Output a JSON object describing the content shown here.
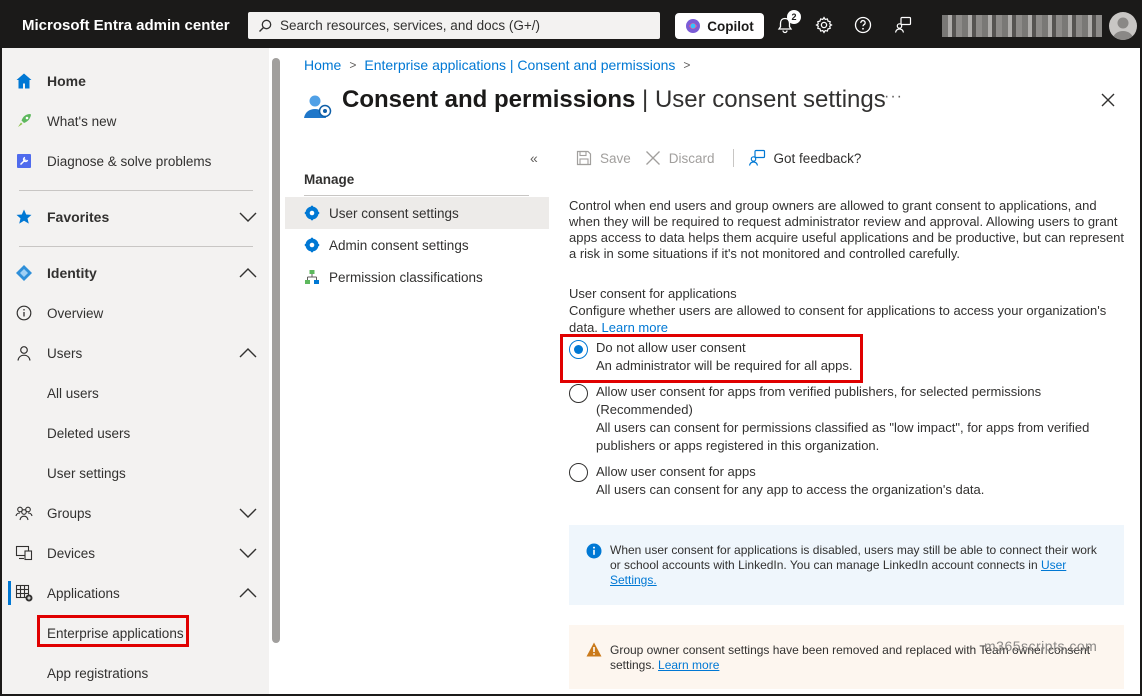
{
  "topbar": {
    "brand": "Microsoft Entra admin center",
    "search_placeholder": "Search resources, services, and docs (G+/)",
    "copilot_label": "Copilot",
    "notification_count": "2"
  },
  "sidebar": {
    "home": "Home",
    "whats_new": "What's new",
    "diagnose": "Diagnose & solve problems",
    "favorites": "Favorites",
    "identity": "Identity",
    "overview": "Overview",
    "users": "Users",
    "all_users": "All users",
    "deleted_users": "Deleted users",
    "user_settings": "User settings",
    "groups": "Groups",
    "devices": "Devices",
    "applications": "Applications",
    "enterprise_applications": "Enterprise applications",
    "app_registrations": "App registrations"
  },
  "breadcrumb": {
    "home": "Home",
    "enterprise": "Enterprise applications | Consent and permissions"
  },
  "page": {
    "title_bold": "Consent and permissions",
    "title_rest": " | User consent settings",
    "ellipsis": "···"
  },
  "submenu": {
    "heading": "Manage",
    "items": [
      {
        "label": "User consent settings"
      },
      {
        "label": "Admin consent settings"
      },
      {
        "label": "Permission classifications"
      }
    ]
  },
  "toolbar": {
    "save": "Save",
    "discard": "Discard",
    "feedback": "Got feedback?"
  },
  "content": {
    "description": "Control when end users and group owners are allowed to grant consent to applications, and when they will be required to request administrator review and approval. Allowing users to grant apps access to data helps them acquire useful applications and be productive, but can represent a risk in some situations if it's not monitored and controlled carefully.",
    "section_title": "User consent for applications",
    "section_desc": "Configure whether users are allowed to consent for applications to access your organization's data.",
    "learn_more": "Learn more",
    "options": [
      {
        "title": "Do not allow user consent",
        "detail": "An administrator will be required for all apps.",
        "selected": true
      },
      {
        "title": "Allow user consent for apps from verified publishers, for selected permissions (Recommended)",
        "detail": "All users can consent for permissions classified as \"low impact\", for apps from verified publishers or apps registered in this organization.",
        "selected": false
      },
      {
        "title": "Allow user consent for apps",
        "detail": "All users can consent for any app to access the organization's data.",
        "selected": false
      }
    ],
    "info_text": "When user consent for applications is disabled, users may still be able to connect their work or school accounts with LinkedIn. You can manage LinkedIn account connects in ",
    "info_link": "User Settings.",
    "warn_text": "Group owner consent settings have been removed and replaced with Team owner consent settings. ",
    "warn_link": "Learn more"
  },
  "watermark": "m365scripts.com",
  "colors": {
    "accent": "#0078d4",
    "highlight": "#e00000",
    "topbar": "#1b1a19"
  }
}
